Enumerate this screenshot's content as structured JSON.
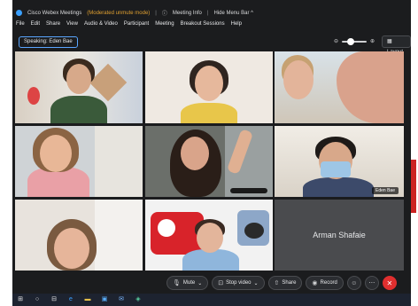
{
  "titlebar": {
    "app_title": "Cisco Webex Meetings",
    "subtitle": "(Moderated unmute mode)",
    "meeting_info": "Meeting Info",
    "hide_menu": "Hide Menu Bar ^"
  },
  "menu": [
    "File",
    "Edit",
    "Share",
    "View",
    "Audio & Video",
    "Participant",
    "Meeting",
    "Breakout Sessions",
    "Help"
  ],
  "speaking_label": "Speaking: Eden Bae",
  "layout_label": "Layout",
  "participants": {
    "active_name": "Eden Bae",
    "avatar_only_name": "Arman Shafaie"
  },
  "controls": {
    "mute": "Mute",
    "stop_video": "Stop video",
    "share": "Share",
    "record": "Record"
  },
  "colors": {
    "accent": "#48b4ff",
    "end_call": "#e02f2f",
    "window_bg": "#1b1c1e"
  },
  "icons": {
    "mic": "mic-icon",
    "video": "video-icon",
    "share": "share-icon",
    "record": "record-icon",
    "reactions": "emoji-icon",
    "more": "more-icon",
    "end": "end-call-icon"
  }
}
